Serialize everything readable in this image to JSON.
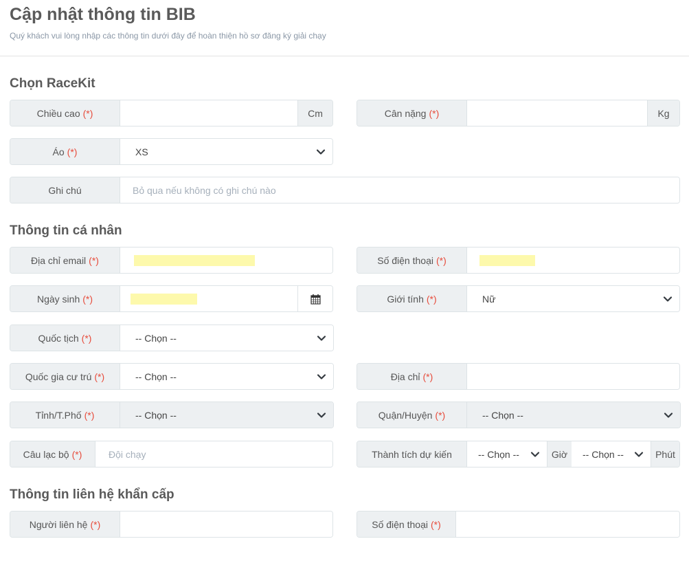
{
  "header": {
    "title": "Cập nhật thông tin BIB",
    "subtitle": "Quý khách vui lòng nhập các thông tin dưới đây để hoàn thiện hồ sơ đăng ký giải chạy"
  },
  "required_mark": "(*)",
  "racekit": {
    "title": "Chọn RaceKit",
    "height": {
      "label": "Chiều cao",
      "value": "",
      "unit": "Cm"
    },
    "weight": {
      "label": "Cân nặng",
      "value": "",
      "unit": "Kg"
    },
    "shirt": {
      "label": "Áo",
      "selected": "XS"
    },
    "note": {
      "label": "Ghi chú",
      "placeholder": "Bỏ qua nếu không có ghi chú nào"
    }
  },
  "personal": {
    "title": "Thông tin cá nhân",
    "email": {
      "label": "Địa chỉ email",
      "value": "[redacted]"
    },
    "phone": {
      "label": "Số điện thoại",
      "value": "[redacted]"
    },
    "dob": {
      "label": "Ngày sinh",
      "value": "[redacted]",
      "icon": "calendar-icon"
    },
    "gender": {
      "label": "Giới tính",
      "selected": "Nữ"
    },
    "nationality": {
      "label": "Quốc tịch",
      "selected": "-- Chọn --"
    },
    "residence_country": {
      "label": "Quốc gia cư trú",
      "selected": "-- Chọn --"
    },
    "address": {
      "label": "Địa chỉ",
      "value": ""
    },
    "province": {
      "label": "Tỉnh/T.Phố",
      "selected": "-- Chọn --"
    },
    "district": {
      "label": "Quận/Huyện",
      "selected": "-- Chọn --"
    },
    "club": {
      "label": "Câu lạc bộ",
      "placeholder": "Đội chạy"
    },
    "expected_time": {
      "label": "Thành tích dự kiến",
      "hours_selected": "-- Chọn --",
      "hours_unit": "Giờ",
      "minutes_selected": "-- Chọn --",
      "minutes_unit": "Phút"
    }
  },
  "emergency": {
    "title": "Thông tin liên hệ khẩn cấp",
    "contact": {
      "label": "Người liên hệ",
      "value": ""
    },
    "phone": {
      "label": "Số điện thoại",
      "value": ""
    }
  }
}
